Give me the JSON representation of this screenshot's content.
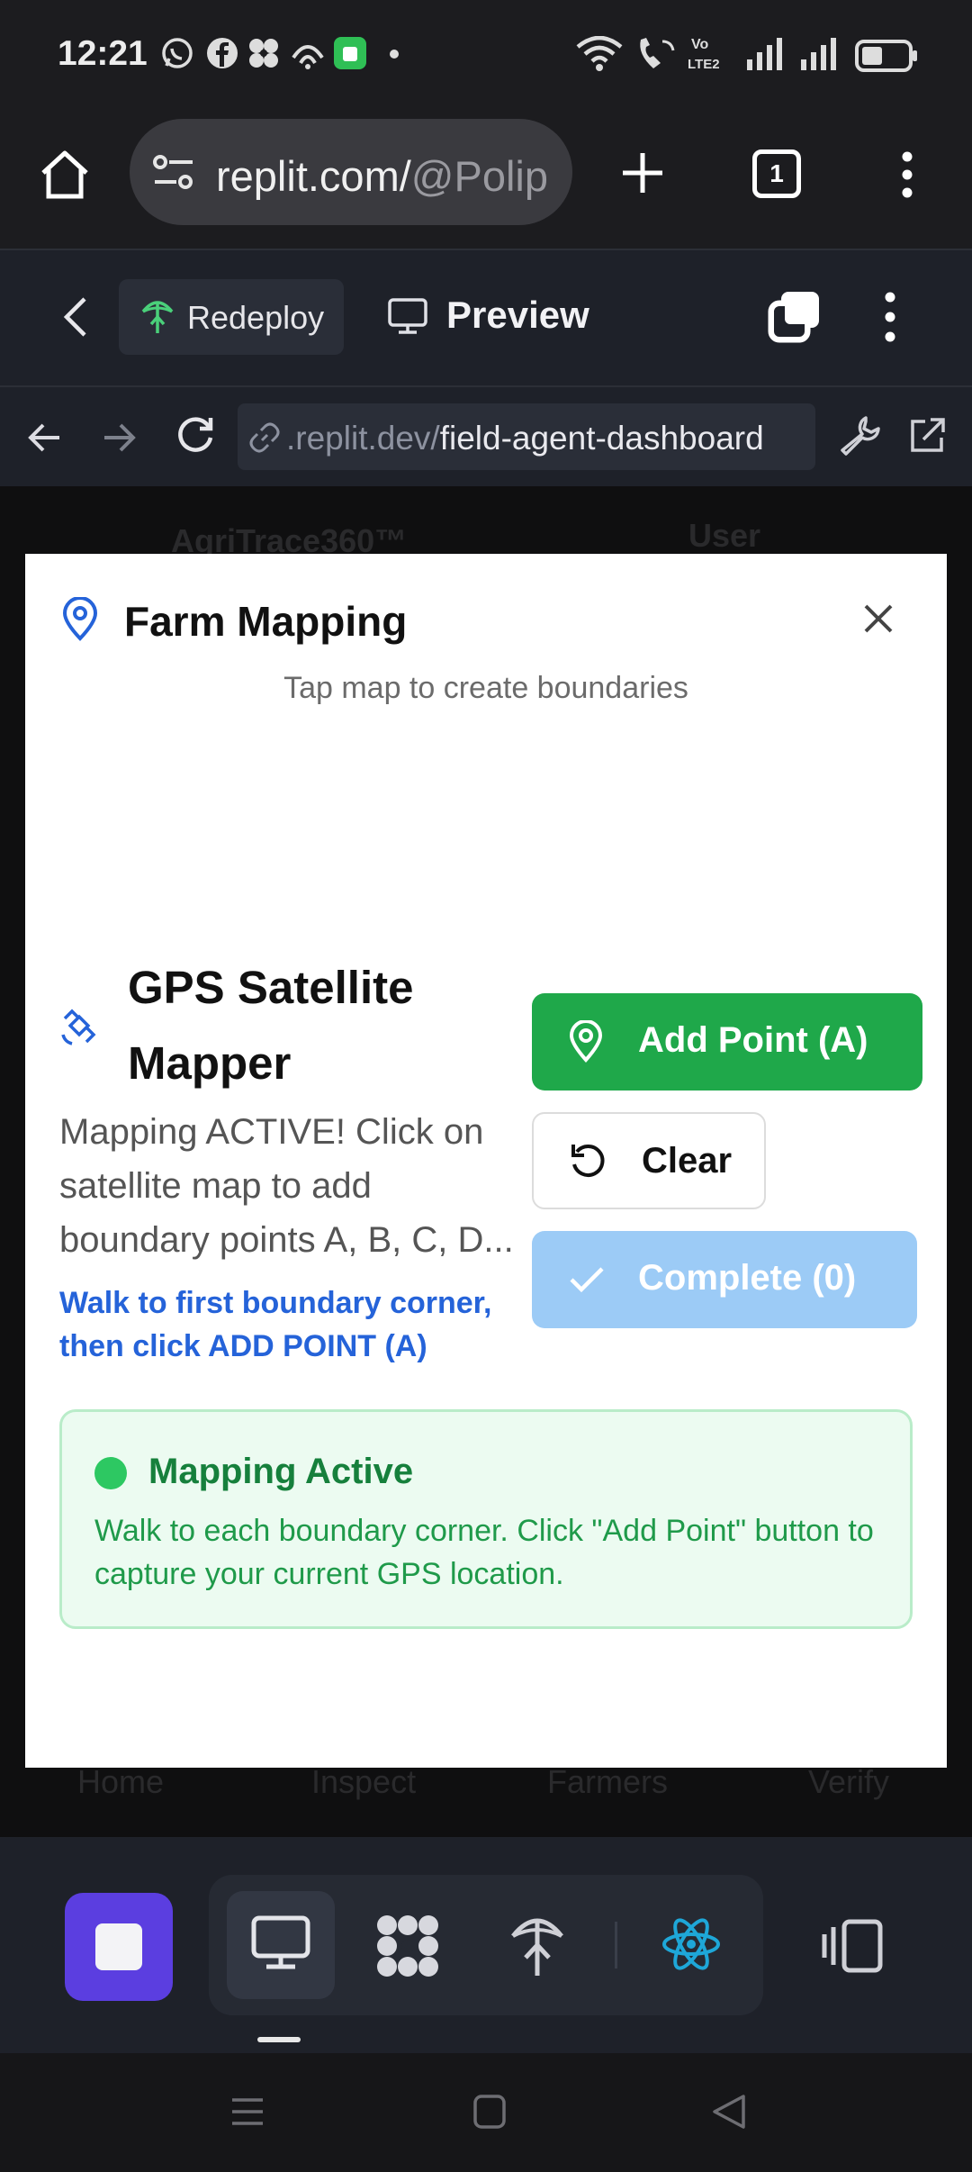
{
  "status_bar": {
    "time": "12:21",
    "icons": [
      "whatsapp-icon",
      "facebook-icon",
      "fan-icon",
      "hotspot-icon",
      "app-icon",
      "dot-icon",
      "wifi-icon",
      "wifi-call-icon",
      "volte-icon",
      "signal-icon",
      "signal-icon",
      "battery-icon"
    ],
    "volte_label": "Vo\nLTE2"
  },
  "browser": {
    "url_main": "replit.com/",
    "url_dim": "@Polip",
    "tab_count": "1"
  },
  "replit_header": {
    "redeploy_label": "Redeploy",
    "preview_label": "Preview"
  },
  "devtools": {
    "url_dim": ".replit.dev/",
    "url_main": "field-agent-dashboard"
  },
  "background_page": {
    "brand": "AgriTrace360™",
    "user": "User",
    "tabs": [
      "Home",
      "Inspect",
      "Farmers",
      "Verify"
    ]
  },
  "modal": {
    "title": "Farm Mapping",
    "subtitle": "Tap map to create boundaries",
    "gps_title": "GPS Satellite Mapper",
    "gps_description": "Mapping ACTIVE! Click on satellite map to add boundary points A, B, C, D...",
    "gps_hint": "Walk to first boundary corner, then click ADD POINT (A)",
    "buttons": {
      "add_point": "Add Point (A)",
      "clear": "Clear",
      "complete": "Complete (0)"
    },
    "status": {
      "title": "Mapping Active",
      "body": "Walk to each boundary corner. Click \"Add Point\" button to capture your current GPS location."
    },
    "colors": {
      "primary_green": "#1fa84a",
      "disabled_blue": "#9ccbf6",
      "link_blue": "#2563d9",
      "status_green": "#16803c"
    }
  }
}
